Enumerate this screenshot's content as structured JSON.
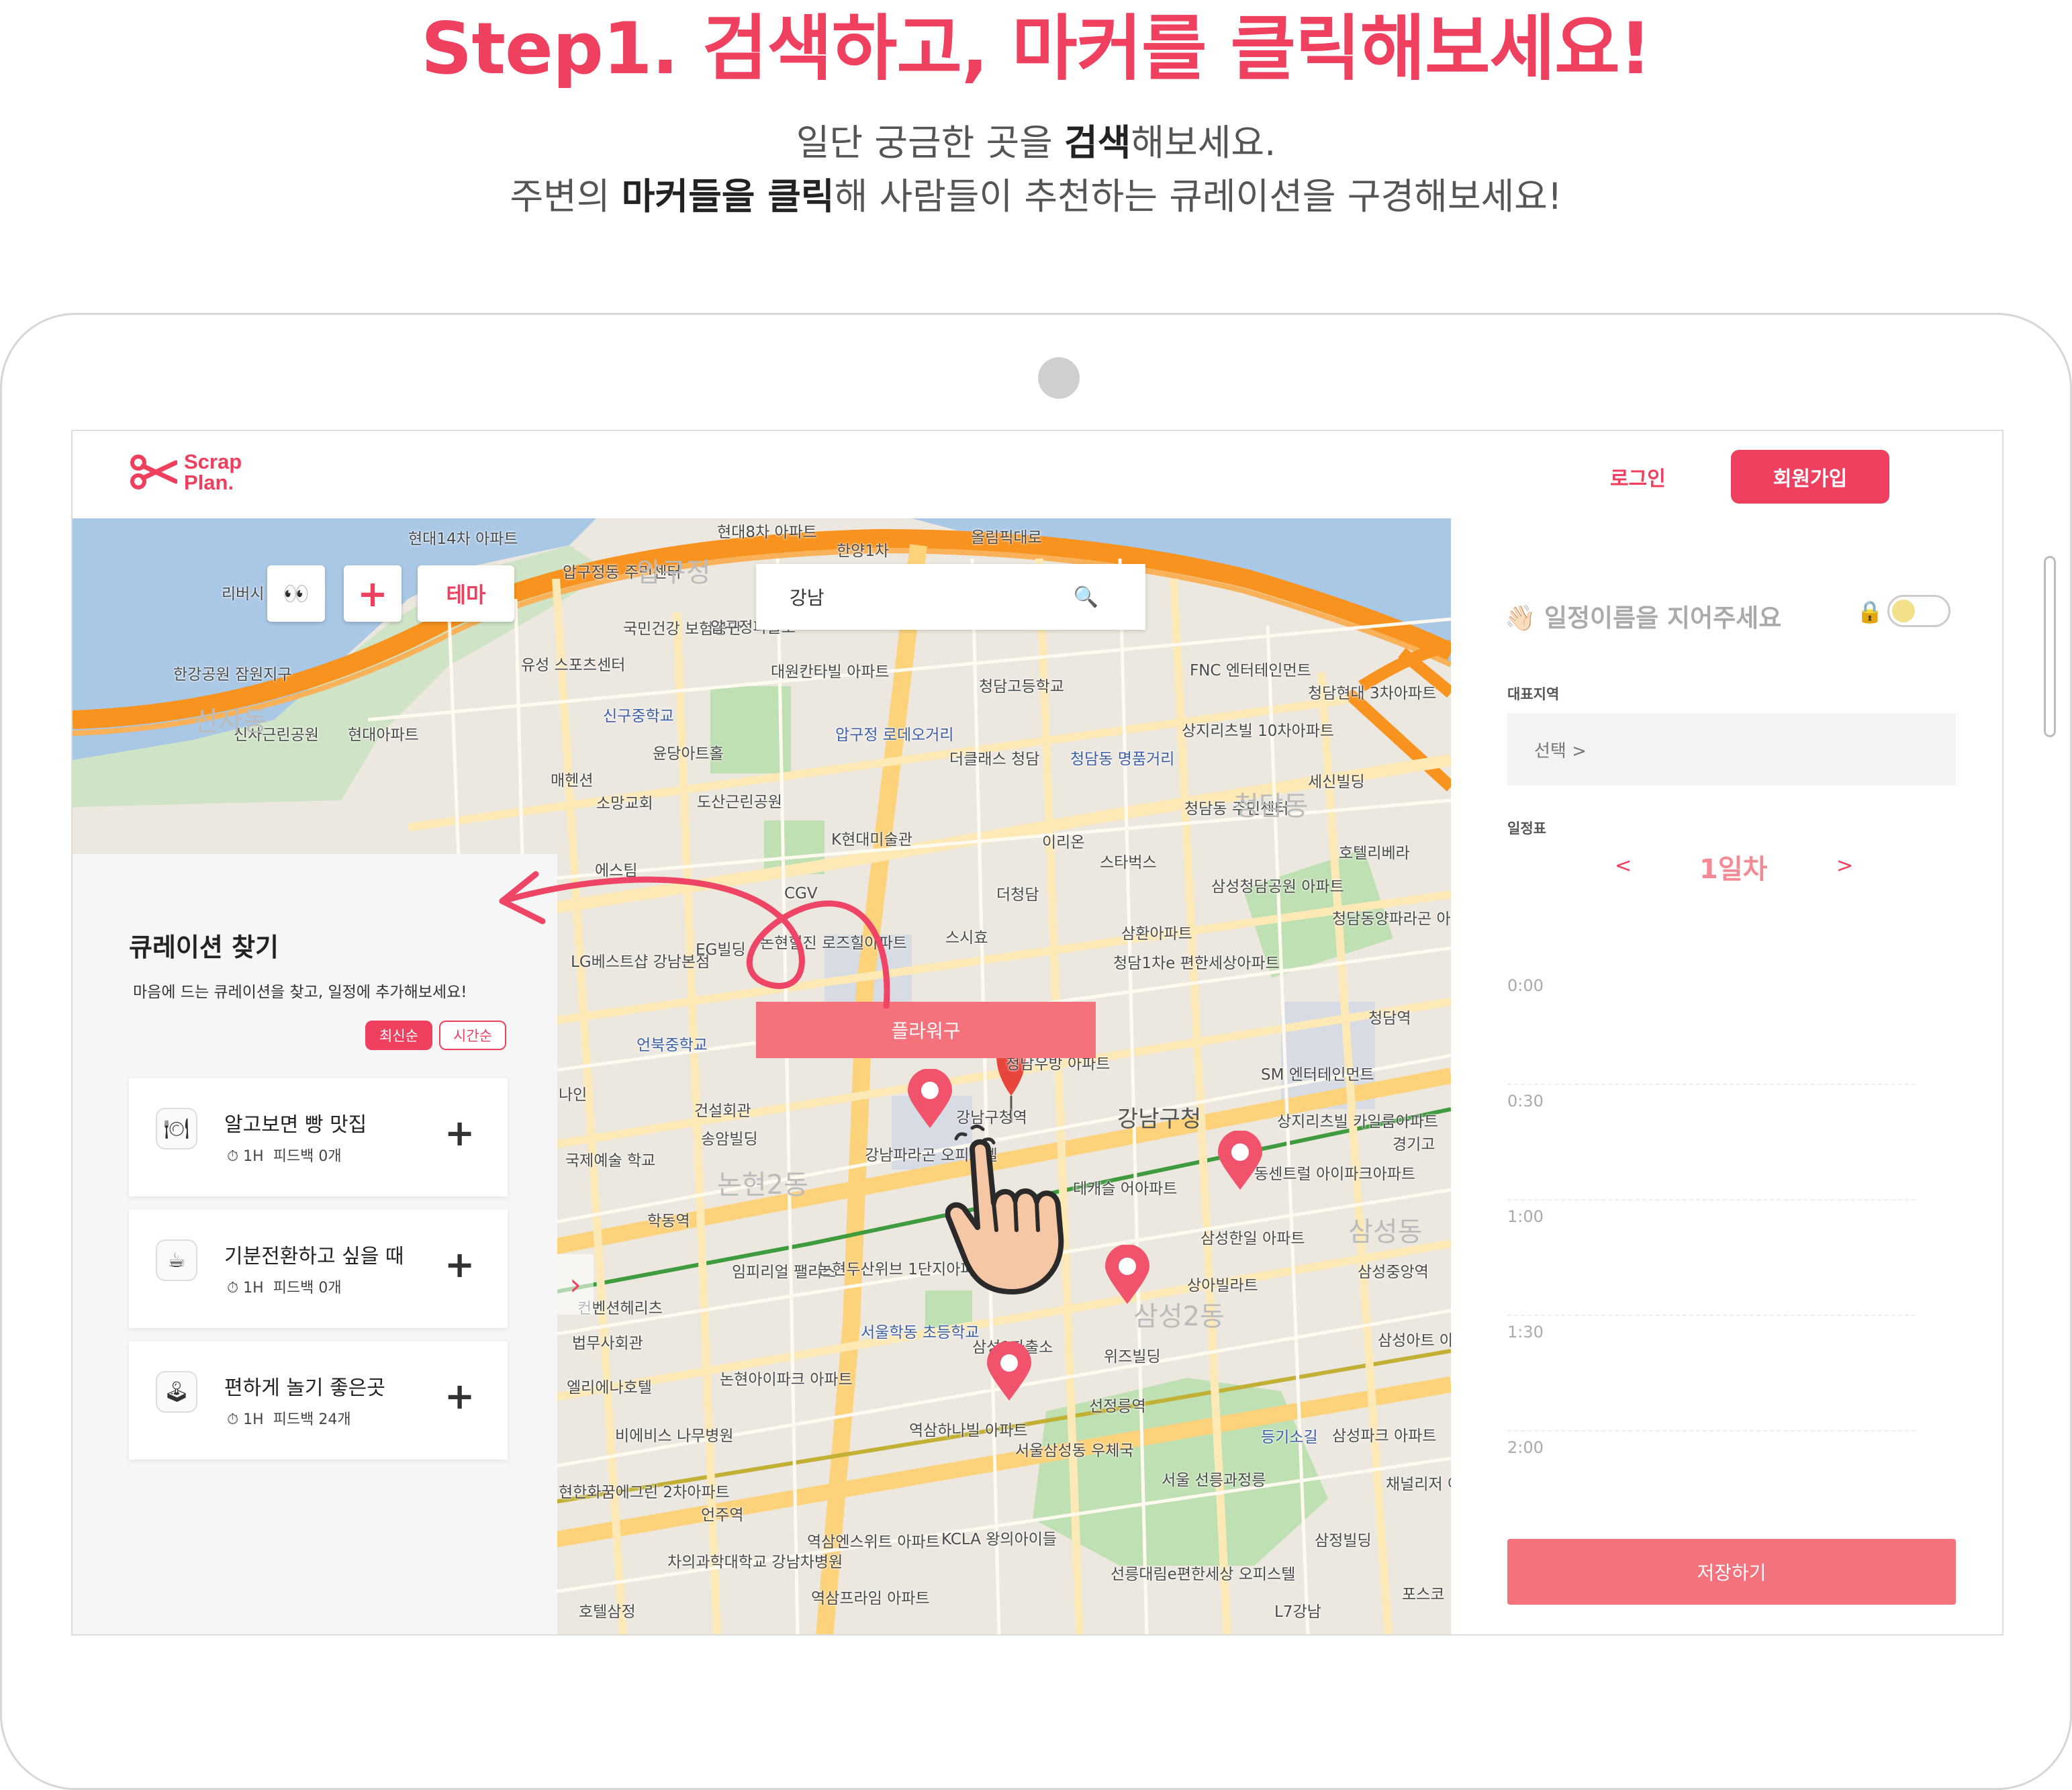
{
  "headline": {
    "title": "Step1. 검색하고, 마커를 클릭해보세요!",
    "line1_a": "일단 궁금한 곳을 ",
    "line1_b": "검색",
    "line1_c": "해보세요.",
    "line2_a": "주변의 ",
    "line2_b": "마커들을 클릭",
    "line2_c": "해 사람들이 추천하는 큐레이션을 구경해보세요!"
  },
  "header": {
    "logo_line1": "Scrap",
    "logo_line2": "Plan.",
    "login": "로그인",
    "signup": "회원가입"
  },
  "map_controls": {
    "eyes_icon": "👀",
    "add_label": "+",
    "theme_label": "테마",
    "search_value": "강남",
    "search_icon": "🔍",
    "flower_tag": "플라워구"
  },
  "map_labels": [
    "현대14차 아파트",
    "현대8차 아파트",
    "한양1차",
    "올림픽대로",
    "압구정동 주민센터",
    "압구정",
    "국민건강 보험공단",
    "압구정파출소",
    "대원칸타빌 아파트",
    "청담고등학교",
    "유성 스포츠센터",
    "신구중학교",
    "윤당아트홀",
    "도산근린공원",
    "압구정 로데오거리",
    "더클래스 청담",
    "청담동 명품거리",
    "상지리츠빌 10차아파트",
    "FNC 엔터테인먼트",
    "청담현대 3차아파트",
    "소망교회",
    "K현대미술관",
    "이리온",
    "스타벅스",
    "청담동 주민센터",
    "세신빌딩",
    "호텔리베라",
    "에스팀",
    "CGV",
    "더청담",
    "삼성청담공원 아파트",
    "청담동양파라곤 아파트",
    "LG베스트샵 강남본점",
    "EG빌딩",
    "논현힐진 로즈힐아파트",
    "스시효",
    "삼환아파트",
    "청담1차e 편한세상아파트",
    "청담역",
    "언북중학교",
    "청담우방 아파트",
    "SM 엔터테인먼트",
    "건설회관",
    "송암빌딩",
    "강남구청역",
    "강남구청",
    "상지리츠빌 카일룸아파트",
    "경기고",
    "강남파라곤 오피스텔",
    "데캐슬 어아파트",
    "동센트럴 아이파크아파트",
    "학동역",
    "임피리얼 팰리스",
    "논현두산위브 1단지아파트",
    "삼성한일 아파트",
    "상아빌라트",
    "삼성중앙역",
    "컨벤션헤리츠",
    "서울학동 초등학교",
    "삼성1파출소",
    "위즈빌딩",
    "삼성아트 아파트",
    "법무사회관",
    "엘리에나호텔",
    "논현아이파크 아파트",
    "선정릉역",
    "비에비스 나무병원",
    "역삼하나빌 아파트",
    "서울삼성동 우체국",
    "서울 선릉과정릉",
    "등기소길",
    "삼성파크 아파트",
    "채널리저 아파트",
    "현한화꿈에그린 2차아파트",
    "언주역",
    "차의과학대학교 강남차병원",
    "역삼엔스위트 아파트",
    "KCLA 왕의아이들",
    "선릉대림e편한세상 오피스텔",
    "삼정빌딩",
    "역삼프라임 아파트",
    "호텔삼정",
    "L7강남",
    "포스코",
    "리버시 수상스키",
    "한강공원 잠원지구",
    "신사근린공원",
    "현대아파트",
    "매헨션",
    "나인",
    "국제예술 학교",
    "논현2동",
    "삼성2동",
    "청담동",
    "신사동",
    "삼성동"
  ],
  "panel": {
    "title": "큐레이션 찾기",
    "desc": "마음에 드는 큐레이션을 찾고, 일정에 추가해보세요!",
    "sort_latest": "최신순",
    "sort_time": "시간순",
    "cards": [
      {
        "icon": "🍽",
        "title": "알고보면 빵 맛집",
        "time": "1H",
        "feedback": "피드백 0개"
      },
      {
        "icon": "☕",
        "title": "기분전환하고 싶을 때",
        "time": "1H",
        "feedback": "피드백 0개"
      },
      {
        "icon": "🕹",
        "title": "편하게 놀기 좋은곳",
        "time": "1H",
        "feedback": "피드백 24개"
      }
    ],
    "next_arrow": "›"
  },
  "plan": {
    "title_icon": "👋🏻",
    "title": "일정이름을 지어주세요",
    "lock_icon": "🔒",
    "region_label": "대표지역",
    "region_value": "선택 >",
    "schedule_label": "일정표",
    "day_prev": "<",
    "day_label": "1일차",
    "day_next": ">",
    "slots": [
      "0:00",
      "0:30",
      "1:00",
      "1:30",
      "2:00"
    ],
    "save": "저장하기"
  },
  "colors": {
    "brand": "#f0405f",
    "brand_soft": "#f3727c",
    "map_water": "#a9c8e6",
    "map_park": "#bfe0b2",
    "map_major_road": "#f7931e",
    "map_road": "#fde9b5"
  }
}
